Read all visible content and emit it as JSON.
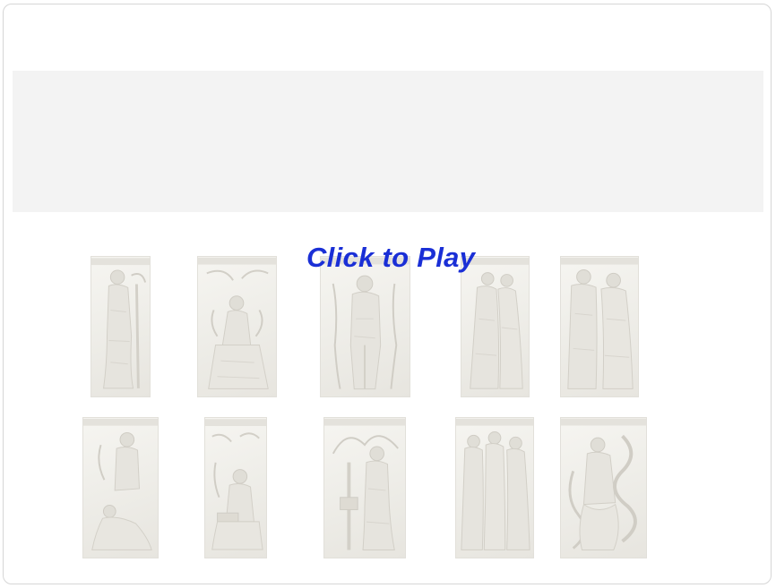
{
  "game": {
    "play_label": "Click to Play"
  },
  "colors": {
    "play_text": "#1a2fd6",
    "banner": "#f3f3f3",
    "frame_border": "#d6d6d6",
    "relief_stone": "#efeee9"
  },
  "panels": {
    "top_row": [
      {
        "icon": "standing-figure-relief-icon"
      },
      {
        "icon": "seated-figure-relief-icon"
      },
      {
        "icon": "figure-group-relief-icon"
      },
      {
        "icon": "robed-figures-relief-icon"
      },
      {
        "icon": "two-figures-relief-icon"
      }
    ],
    "bottom_row": [
      {
        "icon": "reclining-figure-relief-icon"
      },
      {
        "icon": "reading-figure-relief-icon"
      },
      {
        "icon": "angel-figure-relief-icon"
      },
      {
        "icon": "procession-relief-icon"
      },
      {
        "icon": "serpent-figure-relief-icon"
      }
    ]
  }
}
